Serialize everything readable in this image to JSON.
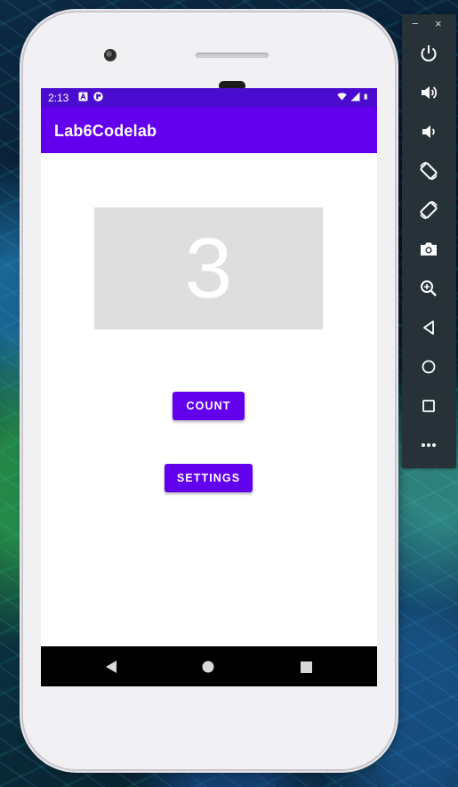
{
  "status_bar": {
    "time": "2:13",
    "icons": [
      "a-notification-icon",
      "app-notification-icon",
      "wifi-icon",
      "signal-icon",
      "battery-icon"
    ]
  },
  "app_bar": {
    "title": "Lab6Codelab",
    "color": "#6200ee",
    "status_color": "#4a0ccf"
  },
  "main": {
    "count_value": "3",
    "count_button_label": "COUNT",
    "settings_button_label": "SETTINGS",
    "button_color": "#6200ee",
    "count_box_color": "#dedede"
  },
  "nav_bar": {
    "items": [
      "back-icon",
      "home-icon",
      "recents-icon"
    ]
  },
  "emulator_toolbar": {
    "minimize_label": "−",
    "close_label": "×",
    "items": [
      "power-icon",
      "volume-up-icon",
      "volume-down-icon",
      "rotate-left-icon",
      "rotate-right-icon",
      "camera-icon",
      "zoom-icon",
      "back-icon",
      "home-icon",
      "overview-icon",
      "more-icon"
    ]
  }
}
